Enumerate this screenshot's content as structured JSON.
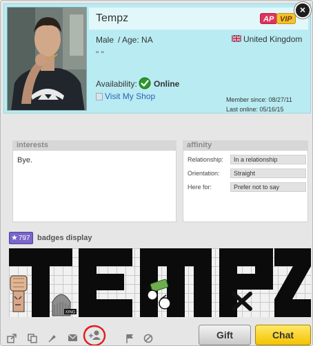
{
  "profile": {
    "username": "Tempz",
    "badges": {
      "ap": "AP",
      "vip": "VIP"
    },
    "gender": "Male",
    "age": "/ Age: NA",
    "country": "United Kingdom",
    "tagline": "\" \"",
    "availability_label": "Availability:",
    "availability_status": "Online",
    "shop_link": "Visit My Shop",
    "member_since": "Member since: 08/27/11",
    "last_online": "Last online: 05/16/15"
  },
  "close_label": "×",
  "interests": {
    "tab": "interests",
    "text": "Bye."
  },
  "affinity": {
    "tab": "affinity",
    "rows": [
      {
        "label": "Relationship:",
        "value": "In a relationship"
      },
      {
        "label": "Orientation:",
        "value": "Straight"
      },
      {
        "label": "Here for:",
        "value": "Prefer not to say"
      }
    ]
  },
  "badges_display": {
    "count": "797",
    "title": "badges display",
    "banner_text": "TEMPZ",
    "knit_cap_text": "XING"
  },
  "footer": {
    "gift_label": "Gift",
    "chat_label": "Chat",
    "icons": [
      "share-icon",
      "copy-icon",
      "pin-icon",
      "message-icon",
      "add-friend-icon",
      "flag-icon",
      "block-icon"
    ]
  },
  "colors": {
    "header_bg": "#b9ebf2",
    "chat_button": "#f4c300",
    "ap_badge": "#e0335d",
    "vip_badge": "#f2c230",
    "online_green": "#2a9a2a",
    "link_blue": "#2a63b8",
    "badge_count_bg": "#7a65c9",
    "annotation_red": "#e02020"
  }
}
